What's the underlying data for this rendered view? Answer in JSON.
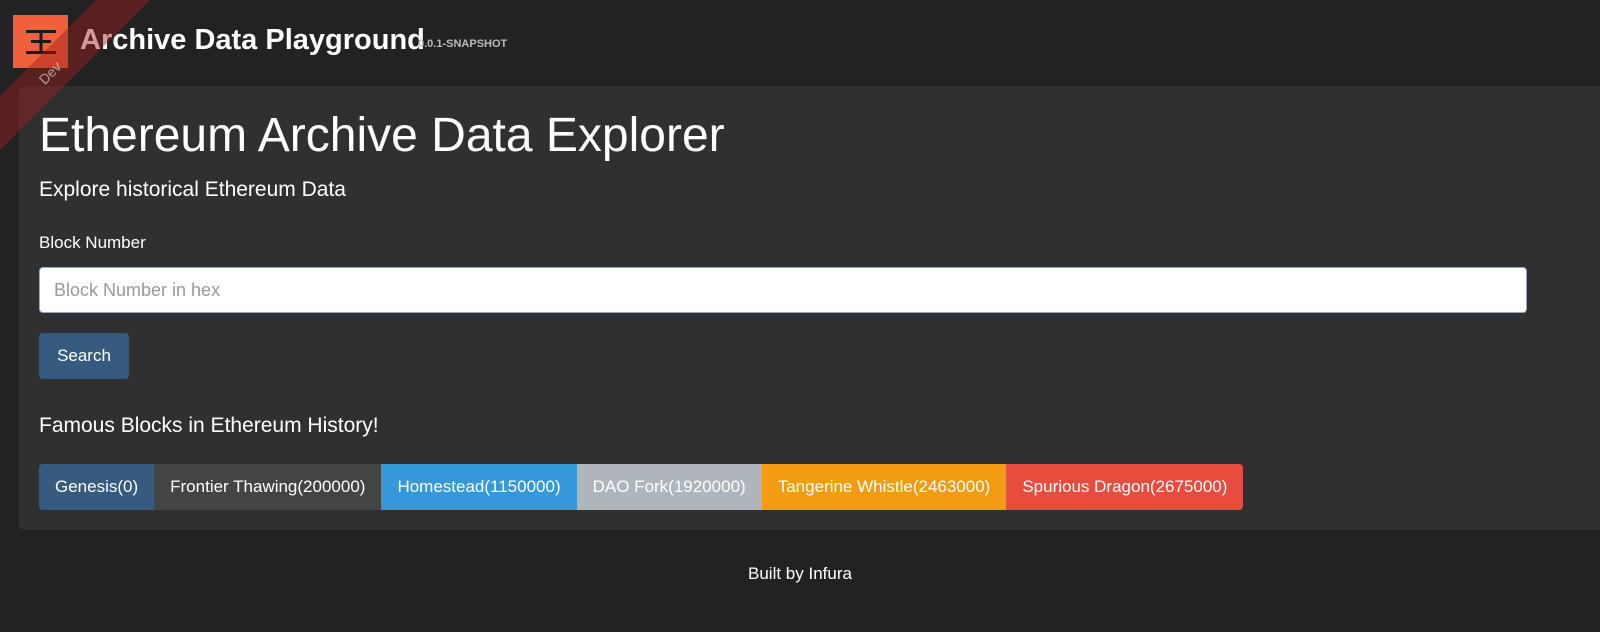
{
  "navbar": {
    "brand": "Archive Data Playground",
    "version": "0.0.1-SNAPSHOT",
    "ribbon": "Dev"
  },
  "main": {
    "title": "Ethereum Archive Data Explorer",
    "subtitle": "Explore historical Ethereum Data",
    "block_label": "Block Number",
    "block_input": {
      "value": "",
      "placeholder": "Block Number in hex"
    },
    "search_label": "Search",
    "famous_title": "Famous Blocks in Ethereum History!",
    "famous_blocks": [
      {
        "label": "Genesis(0)",
        "color": "#375a7f"
      },
      {
        "label": "Frontier Thawing(200000)",
        "color": "#444444"
      },
      {
        "label": "Homestead(1150000)",
        "color": "#3498db"
      },
      {
        "label": "DAO Fork(1920000)",
        "color": "#adb5bd"
      },
      {
        "label": "Tangerine Whistle(2463000)",
        "color": "#f39c12"
      },
      {
        "label": "Spurious Dragon(2675000)",
        "color": "#e74c3c"
      }
    ]
  },
  "footer": {
    "text": "Built by Infura"
  },
  "colors": {
    "background": "#222222",
    "jumbotron": "#303030",
    "logo": "#f0603d",
    "primary": "#375a7f"
  },
  "icons": {
    "logo": "infura-logo-icon"
  }
}
